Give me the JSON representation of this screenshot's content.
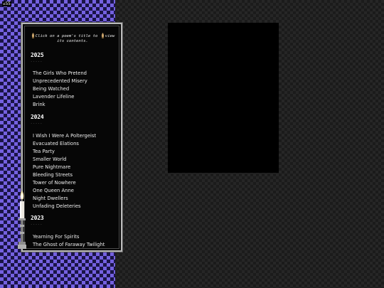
{
  "corner_label": "☠55",
  "intro": {
    "before": "Click on a poem's title to",
    "after": "view its contents.",
    "icon": "candle-flame-icon"
  },
  "sections": [
    {
      "year": "2025",
      "separator": "-----",
      "poems": [
        "The Girls Who Pretend",
        "Unprecedented Misery",
        "Being Watched",
        "Lavender Lifeline",
        "Brink"
      ]
    },
    {
      "year": "2024",
      "separator": "-----",
      "poems": [
        "I Wish I Were A Poltergeist",
        "Evacuated Elations",
        "Tea Party",
        "Smaller World",
        "Pure Nightmare",
        "Bleeding Streets",
        "Tower of Nowhere",
        "One Queen Anne",
        "Night Dwellers",
        "Unfading Deleteries"
      ]
    },
    {
      "year": "2023",
      "separator": "-----",
      "poems": [
        "Yearning For Spirits",
        "The Ghost of Faraway Twilight"
      ]
    }
  ],
  "colors": {
    "purple_check": "#7461e0",
    "dark_check": "#262626",
    "panel_bg": "#060606",
    "panel_border": "#b8b8b8"
  }
}
